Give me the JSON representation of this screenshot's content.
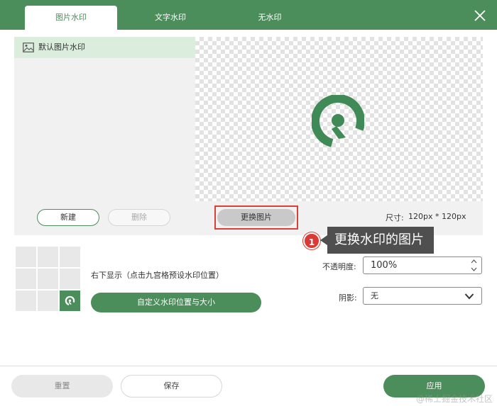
{
  "tabs": [
    {
      "label": "图片水印"
    },
    {
      "label": "文字水印"
    },
    {
      "label": "无水印"
    }
  ],
  "list": {
    "items": [
      {
        "label": "默认图片水印",
        "icon": "image-icon"
      }
    ],
    "new_label": "新建",
    "delete_label": "删除"
  },
  "preview": {
    "change_image_label": "更换图片",
    "size_label": "尺寸:",
    "size_value": "120px * 120px"
  },
  "annotation": {
    "number": "1",
    "text": "更换水印的图片"
  },
  "position": {
    "selected": "bottom-right",
    "description": "右下显示（点击九宫格预设水印位置）",
    "custom_button": "自定义水印位置与大小"
  },
  "opacity": {
    "label": "不透明度:",
    "value": "100%"
  },
  "shadow": {
    "label": "阴影:",
    "value": "无"
  },
  "footer": {
    "reset_label": "重置",
    "save_label": "保存",
    "apply_label": "应用"
  },
  "source_watermark": "@稀土掘金技术社区",
  "colors": {
    "accent": "#4c8d5c",
    "highlight": "#d6413a",
    "badge": "#d93a36",
    "callout": "#4f4f4f"
  }
}
